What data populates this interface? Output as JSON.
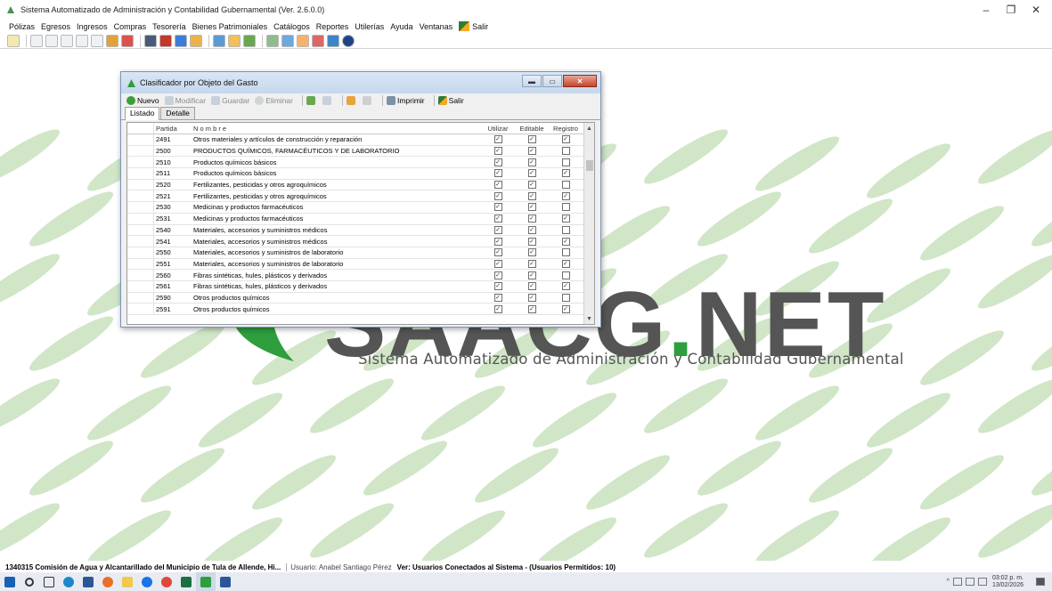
{
  "app": {
    "title": "Sistema Automatizado de Administración y Contabilidad Gubernamental  (Ver. 2.6.0.0)",
    "minimize": "–",
    "maximize": "❐",
    "close": "✕"
  },
  "menu": [
    "Pólizas",
    "Egresos",
    "Ingresos",
    "Compras",
    "Tesorería",
    "Bienes Patrimoniales",
    "Catálogos",
    "Reportes",
    "Utilerías",
    "Ayuda",
    "Ventanas"
  ],
  "menu_salir": "Salir",
  "background": {
    "brand": "SAACG.NET",
    "brand_prefix": "SAACG",
    "brand_dot": ".",
    "brand_suffix": "NET",
    "subtitle": "Sistema Automatizado de Administración y Contabilidad Gubernamental"
  },
  "dialog": {
    "title": "Clasificador por Objeto del Gasto",
    "toolbar": {
      "nuevo": "Nuevo",
      "modificar": "Modificar",
      "guardar": "Guardar",
      "eliminar": "Eliminar",
      "imprimir": "Imprimir",
      "salir": "Salir"
    },
    "tabs": [
      "Listado",
      "Detalle"
    ],
    "columns": {
      "partida": "Partida",
      "nombre": "N o m b r e",
      "utilizar": "Utilizar",
      "editable": "Editable",
      "registro": "Registro"
    },
    "rows": [
      {
        "partida": "2491",
        "nombre": "Otros materiales y artículos de construcción y reparación",
        "utilizar": true,
        "editable": true,
        "registro": true
      },
      {
        "partida": "2500",
        "nombre": "PRODUCTOS QUÍMICOS, FARMACÉUTICOS Y DE LABORATORIO",
        "utilizar": true,
        "editable": true,
        "registro": false
      },
      {
        "partida": "2510",
        "nombre": "Productos químicos básicos",
        "utilizar": true,
        "editable": true,
        "registro": false
      },
      {
        "partida": "2511",
        "nombre": "Productos químicos básicos",
        "utilizar": true,
        "editable": true,
        "registro": true
      },
      {
        "partida": "2520",
        "nombre": "Fertilizantes, pesticidas y otros agroquímicos",
        "utilizar": true,
        "editable": true,
        "registro": false
      },
      {
        "partida": "2521",
        "nombre": "Fertilizantes, pesticidas y otros agroquímicos",
        "utilizar": true,
        "editable": true,
        "registro": true
      },
      {
        "partida": "2530",
        "nombre": "Medicinas y productos farmacéuticos",
        "utilizar": true,
        "editable": true,
        "registro": false
      },
      {
        "partida": "2531",
        "nombre": "Medicinas y productos farmacéuticos",
        "utilizar": true,
        "editable": true,
        "registro": true
      },
      {
        "partida": "2540",
        "nombre": "Materiales, accesorios y suministros médicos",
        "utilizar": true,
        "editable": true,
        "registro": false
      },
      {
        "partida": "2541",
        "nombre": "Materiales, accesorios y suministros médicos",
        "utilizar": true,
        "editable": true,
        "registro": true
      },
      {
        "partida": "2550",
        "nombre": "Materiales, accesorios y suministros de laboratorio",
        "utilizar": true,
        "editable": true,
        "registro": false
      },
      {
        "partida": "2551",
        "nombre": "Materiales, accesorios y suministros de laboratorio",
        "utilizar": true,
        "editable": true,
        "registro": true
      },
      {
        "partida": "2560",
        "nombre": "Fibras sintéticas, hules, plásticos y derivados",
        "utilizar": true,
        "editable": true,
        "registro": false
      },
      {
        "partida": "2561",
        "nombre": "Fibras sintéticas, hules, plásticos y derivados",
        "utilizar": true,
        "editable": true,
        "registro": true
      },
      {
        "partida": "2590",
        "nombre": "Otros productos químicos",
        "utilizar": true,
        "editable": true,
        "registro": false
      },
      {
        "partida": "2591",
        "nombre": "Otros productos químicos",
        "utilizar": true,
        "editable": true,
        "registro": true
      }
    ]
  },
  "status": {
    "entity": "1340315 Comisión de Agua y Alcantarillado del Municipio de Tula de Allende, Hi...",
    "user": "Usuario: Anabel Santiago Pérez",
    "connected": "Ver: Usuarios Conectados al Sistema - (Usuarios Permitidos: 10)"
  },
  "tray": {
    "time": "03:02 p. m.",
    "date": "13/02/2026"
  },
  "colors": {
    "brand_green": "#2e9e3e",
    "dialog_close": "#c8432c",
    "taskbar": "#e8ecf2"
  }
}
